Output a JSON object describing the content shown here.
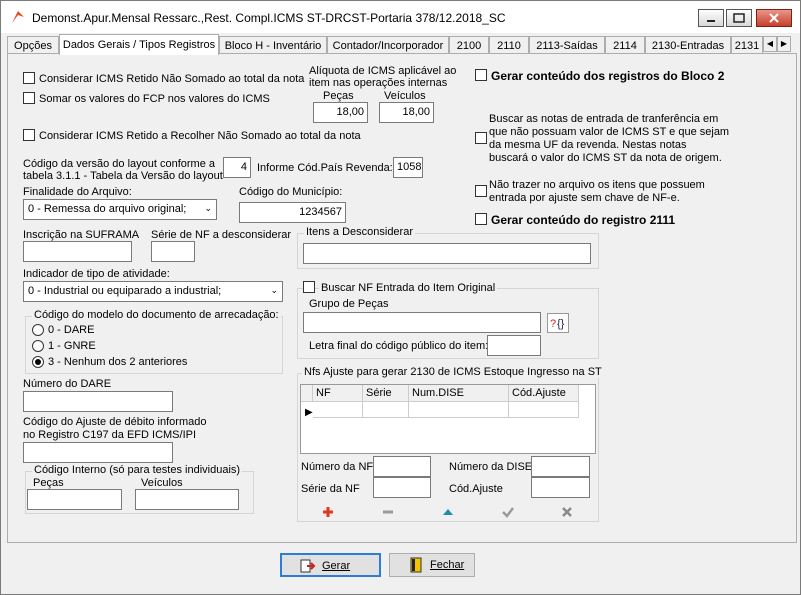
{
  "window": {
    "title": "Demonst.Apur.Mensal Ressarc.,Rest. Compl.ICMS ST-DRCST-Portaria 378/12.2018_SC"
  },
  "tabs": [
    {
      "label": "Opções"
    },
    {
      "label": "Dados Gerais / Tipos Registros"
    },
    {
      "label": "Bloco H - Inventário"
    },
    {
      "label": "Contador/Incorporador"
    },
    {
      "label": "2100"
    },
    {
      "label": "2110"
    },
    {
      "label": "2113-Saídas"
    },
    {
      "label": "2114"
    },
    {
      "label": "2130-Entradas"
    },
    {
      "label": "2131"
    }
  ],
  "left": {
    "chk_icms_retido": "Considerar ICMS Retido Não Somado ao total da nota",
    "chk_fcp": "Somar os valores do FCP  nos valores do ICMS",
    "aliquota_label": "Alíquota de ICMS aplicável ao item nas operações internas",
    "pecas_label": "Peças",
    "veiculos_label": "Veículos",
    "pecas_value": "18,00",
    "veiculos_value": "18,00",
    "chk_icms_recolher": "Considerar ICMS Retido a Recolher Não Somado ao total da nota",
    "versao_label_1": "Código da versão do layout conforme a",
    "versao_label_2": "tabela 3.1.1 - Tabela da Versão do layout",
    "versao_value": "4",
    "pais_label": "Informe Cód.País Revenda:",
    "pais_value": "1058",
    "finalidade_label": "Finalidade do Arquivo:",
    "finalidade_value": "0 - Remessa do arquivo original;",
    "municipio_label": "Código do Município:",
    "municipio_value": "1234567",
    "suframa_label": "Inscrição na SUFRAMA",
    "serie_label": "Série de NF a desconsiderar",
    "atividade_label": "Indicador de tipo de atividade:",
    "atividade_value": "0 - Industrial ou equiparado a industrial;",
    "modelo_group": "Código do modelo do documento de arrecadação:",
    "radio_0": "0 - DARE",
    "radio_1": "1 - GNRE",
    "radio_3": "3 - Nenhum dos 2 anteriores",
    "dare_label": "Número do DARE",
    "ajuste_label_1": "Código do Ajuste de débito informado",
    "ajuste_label_2": "no Registro C197 da EFD ICMS/IPI",
    "interno_group": "Código Interno (só para testes individuais)",
    "interno_pecas": "Peças",
    "interno_veiculos": "Veículos"
  },
  "middle": {
    "itens_group": "Itens a Desconsiderar",
    "buscar_nf_chk": "Buscar NF Entrada do Item Original",
    "grupo_pecas_label": "Grupo de Peças",
    "letra_label": "Letra final do código público do item:",
    "nfs_group": "Nfs Ajuste para gerar 2130 de ICMS Estoque Ingresso na ST",
    "grid_headers": [
      "NF",
      "Série",
      "Num.DISE",
      "Cód.Ajuste"
    ],
    "numero_nf_label": "Número da NF",
    "numero_dise_label": "Número da DISE",
    "serie_nf_label": "Série da NF",
    "cod_ajuste_label": "Cód.Ajuste",
    "nav_icons": [
      "plus-icon",
      "minus-icon",
      "up-icon",
      "check-icon",
      "x-icon"
    ]
  },
  "right": {
    "chk_bloco2": "Gerar conteúdo dos registros do Bloco 2",
    "buscar_notas_text_1": "Buscar as notas de entrada de tranferência em",
    "buscar_notas_text_2": "que não possuam valor de ICMS ST e que sejam",
    "buscar_notas_text_3": "da mesma UF da revenda. Nestas notas",
    "buscar_notas_text_4": "buscará o valor do ICMS ST da nota de origem.",
    "nao_trazer_1": "Não trazer no arquivo os itens que possuem",
    "nao_trazer_2": "entrada por ajuste sem chave de NF-e.",
    "chk_2111": "Gerar conteúdo do registro 2111"
  },
  "buttons": {
    "gerar": "Gerar",
    "fechar": "Fechar"
  },
  "colors": {
    "accent": "#2f7cd3",
    "plus": "#e03a1e",
    "up": "#1a8fb0"
  }
}
